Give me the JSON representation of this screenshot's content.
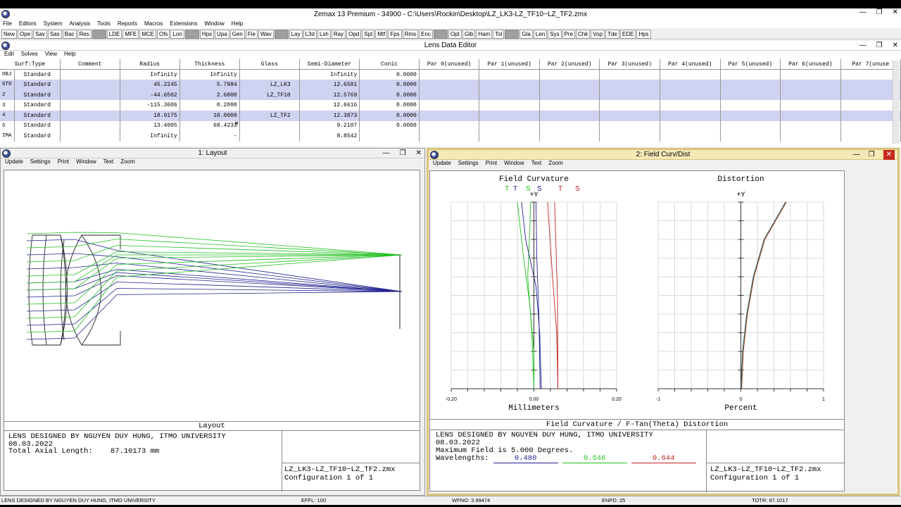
{
  "app": {
    "title": "Zemax 13 Premium - 34900 - C:\\Users\\Rockin\\Desktop\\LZ_LK3-LZ_TF10~LZ_TF2.zmx",
    "menu": [
      "File",
      "Editors",
      "System",
      "Analysis",
      "Tools",
      "Reports",
      "Macros",
      "Extensions",
      "Window",
      "Help"
    ],
    "toolbar": [
      "New",
      "Ope",
      "Sav",
      "Sas",
      "Bac",
      "Res",
      "",
      "LDE",
      "MFE",
      "MCE",
      "Ofs",
      "Lon",
      "",
      "Hps",
      "Upa",
      "Gen",
      "Fie",
      "Wav",
      "",
      "Lay",
      "L3d",
      "Lsh",
      "Ray",
      "Opd",
      "Spt",
      "Mtf",
      "Fps",
      "Rms",
      "Enc",
      "",
      "Opt",
      "Glb",
      "Ham",
      "Tol",
      "",
      "Gla",
      "Len",
      "Sys",
      "Pre",
      "Chk",
      "Vop",
      "Tde",
      "EDE",
      "Hps"
    ]
  },
  "lde": {
    "title": "Lens Data Editor",
    "menu": [
      "Edit",
      "Solves",
      "View",
      "Help"
    ],
    "headers": [
      "Surf:Type",
      "Comment",
      "Radius",
      "Thickness",
      "Glass",
      "Semi-Diameter",
      "Conic",
      "Par 0(unused)",
      "Par 1(unused)",
      "Par 2(unused)",
      "Par 3(unused)",
      "Par 4(unused)",
      "Par 5(unused)",
      "Par 6(unused)",
      "Par 7(unuse"
    ],
    "rows": [
      {
        "s": "OBJ",
        "type": "Standard",
        "radius": "Infinity",
        "thick": "Infinity",
        "tflag": "",
        "glass": "",
        "semi": "Infinity",
        "conic": "0.0000",
        "hl": false
      },
      {
        "s": "STO",
        "type": "Standard",
        "radius": "45.2245",
        "thick": "5.7984",
        "tflag": "",
        "glass": "LZ_LK3",
        "semi": "12.6581",
        "conic": "0.0000",
        "hl": true
      },
      {
        "s": "2",
        "type": "Standard",
        "radius": "-44.6502",
        "thick": "2.6800",
        "tflag": "",
        "glass": "LZ_TF10",
        "semi": "12.5769",
        "conic": "0.0000",
        "hl": true
      },
      {
        "s": "3",
        "type": "Standard",
        "radius": "-115.3606",
        "thick": "0.2000",
        "tflag": "",
        "glass": "",
        "semi": "12.6616",
        "conic": "0.0000",
        "hl": false
      },
      {
        "s": "4",
        "type": "Standard",
        "radius": "18.9175",
        "thick": "10.0000",
        "tflag": "",
        "glass": "LZ_TF2",
        "semi": "12.3873",
        "conic": "0.0000",
        "hl": true
      },
      {
        "s": "5",
        "type": "Standard",
        "radius": "13.4005",
        "thick": "68.4233",
        "tflag": "M",
        "glass": "",
        "semi": "9.2107",
        "conic": "0.0000",
        "hl": false
      },
      {
        "s": "IMA",
        "type": "Standard",
        "radius": "Infinity",
        "thick": "-",
        "tflag": "",
        "glass": "",
        "semi": "8.8542",
        "conic": "",
        "hl": false
      }
    ]
  },
  "layout": {
    "title": "1: Layout",
    "menu": [
      "Update",
      "Settings",
      "Print",
      "Window",
      "Text",
      "Zoom"
    ],
    "caption": "Layout",
    "info": [
      "LENS DESIGNED BY NGUYEN DUY HUNG, ITMO UNIVERSITY",
      "08.03.2022",
      "Total Axial Length:    87.10173 mm"
    ],
    "file": "LZ_LK3-LZ_TF10~LZ_TF2.zmx",
    "config": "Configuration 1 of 1"
  },
  "fc": {
    "title": "2: Field Curv/Dist",
    "menu": [
      "Update",
      "Settings",
      "Print",
      "Window",
      "Text",
      "Zoom"
    ],
    "fc_title": "Field Curvature",
    "dist_title": "Distortion",
    "axis_y": "+Y",
    "fc_xticks": [
      "-0.20",
      "0.00",
      "0.20"
    ],
    "dist_xticks": [
      "-1",
      "0",
      "1"
    ],
    "fc_xlabel": "Millimeters",
    "dist_xlabel": "Percent",
    "legend": [
      {
        "t": "T",
        "c": "#20c020"
      },
      {
        "t": "T",
        "c": "#202090"
      },
      {
        "t": "S",
        "c": "#20c020"
      },
      {
        "t": "S",
        "c": "#202090"
      },
      {
        "t": "T",
        "c": "#c02020"
      },
      {
        "t": "S",
        "c": "#c02020"
      }
    ],
    "caption": "Field Curvature / F-Tan(Theta) Distortion",
    "info": [
      "LENS DESIGNED BY NGUYEN DUY HUNG, ITMO UNIVERSITY",
      "08.03.2022",
      "Maximum Field is 5.000 Degrees.",
      "Wavelengths:"
    ],
    "wavelengths": [
      {
        "v": "0.480",
        "c": "#202090"
      },
      {
        "v": "0.546",
        "c": "#20c020"
      },
      {
        "v": "0.644",
        "c": "#c02020"
      }
    ],
    "file": "LZ_LK3-LZ_TF10~LZ_TF2.zmx",
    "config": "Configuration 1 of 1"
  },
  "status": [
    "LENS DESIGNED BY NGUYEN DUY HUNG, ITMO UNIVERSITY",
    "EFFL: 100",
    "WFNO: 3.99474",
    "ENPD: 25",
    "TOTR: 87.1017"
  ],
  "colors": {
    "green": "#20c020",
    "blue": "#202090",
    "red": "#c02020",
    "selected": "#cfd2f0"
  }
}
